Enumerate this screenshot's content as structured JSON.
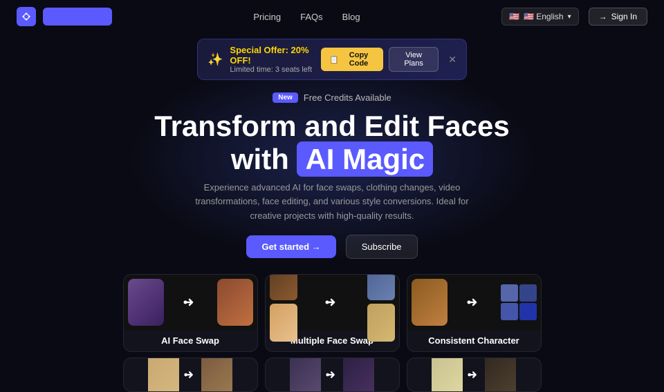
{
  "navbar": {
    "logo_text": "",
    "links": [
      {
        "label": "Pricing",
        "id": "pricing"
      },
      {
        "label": "FAQs",
        "id": "faqs"
      },
      {
        "label": "Blog",
        "id": "blog"
      }
    ],
    "language": "🇺🇸 English",
    "sign_in": "Sign In"
  },
  "banner": {
    "title": "Special Offer: 20% OFF!",
    "subtitle": "Limited time: 3 seats left",
    "copy_code_label": "Copy Code",
    "view_plans_label": "View Plans"
  },
  "hero": {
    "badge": "New",
    "free_credits": "Free Credits Available",
    "title_line1": "Transform and Edit Faces",
    "title_line2": "with",
    "title_highlight": "AI Magic",
    "subtitle": "Experience advanced AI for face swaps, clothing changes, video transformations, face editing, and various style conversions. Ideal for creative projects with high-quality results.",
    "get_started": "Get started →",
    "subscribe": "Subscribe"
  },
  "feature_cards": [
    {
      "label": "AI Face Swap",
      "id": "ai-face-swap"
    },
    {
      "label": "Multiple Face Swap",
      "id": "multiple-face-swap"
    },
    {
      "label": "Consistent Character",
      "id": "consistent-character"
    }
  ],
  "bottom_cards": [
    {
      "label": "",
      "id": "bottom-1"
    },
    {
      "label": "",
      "id": "bottom-2"
    },
    {
      "label": "",
      "id": "bottom-3"
    }
  ]
}
